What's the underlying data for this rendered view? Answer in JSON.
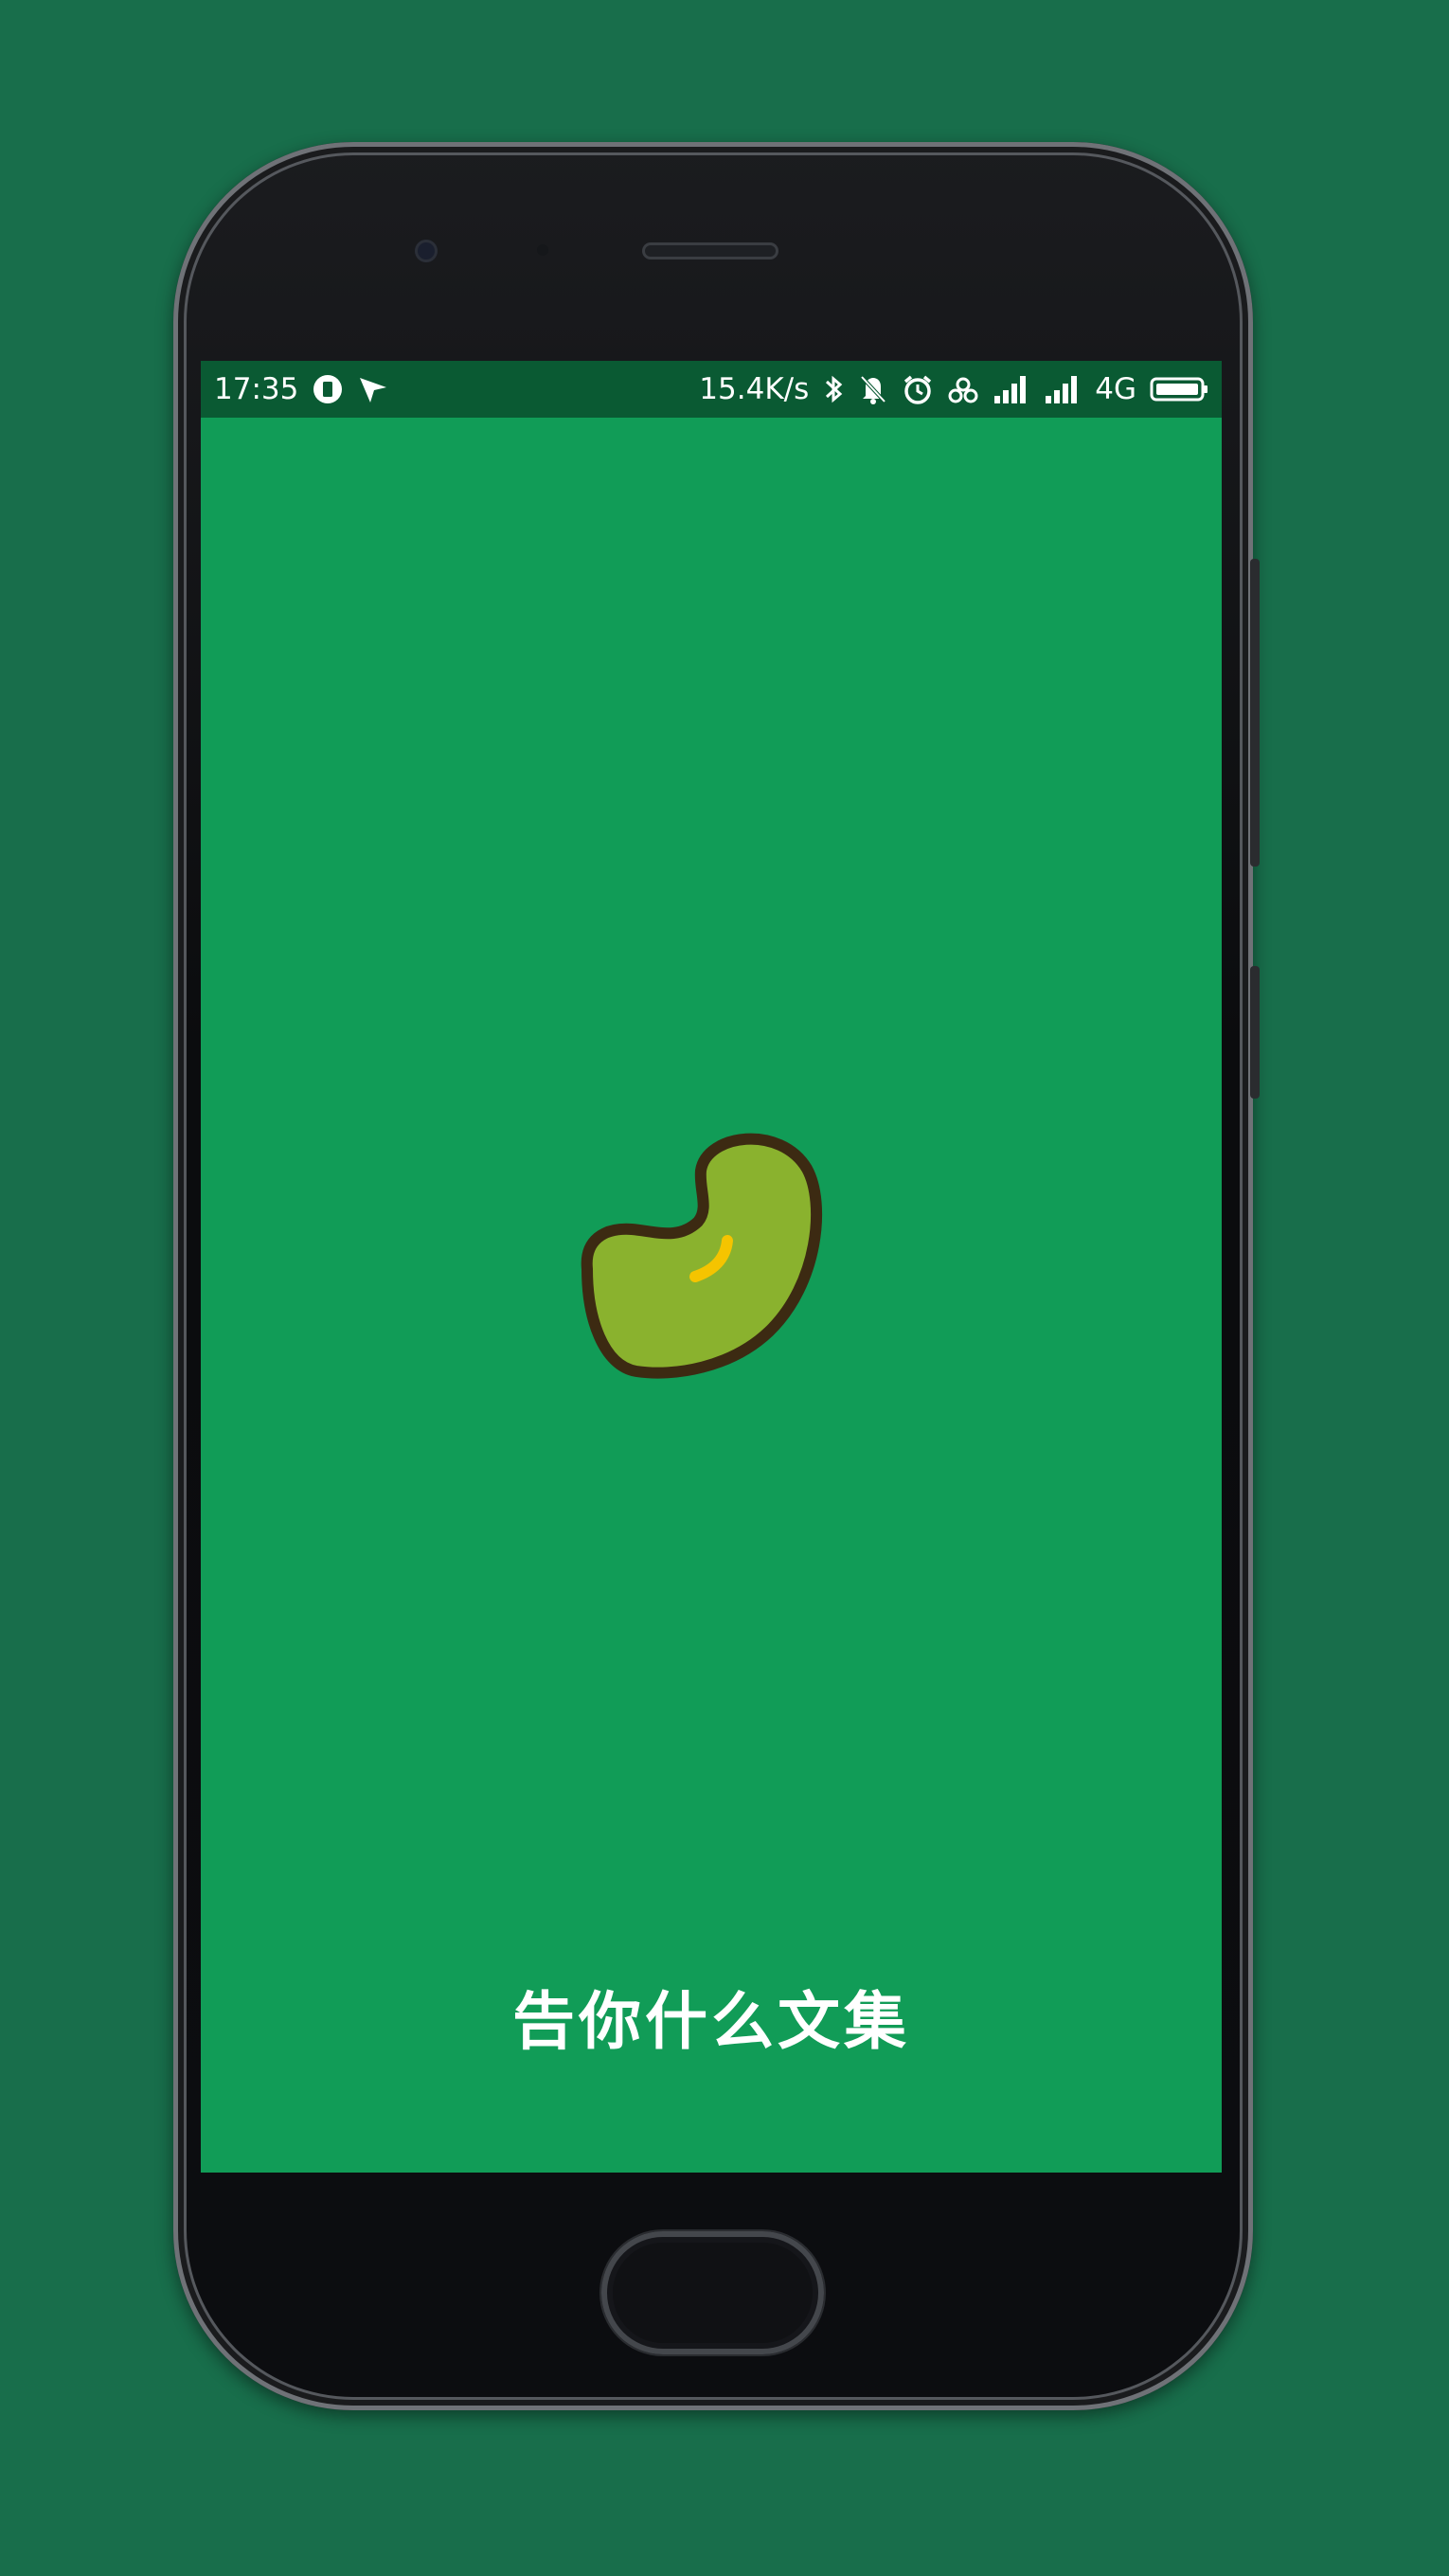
{
  "status_bar": {
    "time": "17:35",
    "net_speed": "15.4K/s",
    "network_type": "4G",
    "icons": [
      "sim-card-icon",
      "location-arrow-icon",
      "bluetooth-icon",
      "mute-bell-icon",
      "alarm-icon",
      "hotspot-icon",
      "signal-icon",
      "signal-icon",
      "battery-icon"
    ]
  },
  "splash": {
    "logo_icon": "bean-icon",
    "app_name": "告你什么文集"
  },
  "colors": {
    "page_background": "#186e4b",
    "screen_background": "#119c57",
    "status_bar_background": "#0a5a33",
    "bean_fill": "#8ab22e",
    "bean_outline": "#3c2a12",
    "bean_highlight": "#f5c400"
  }
}
